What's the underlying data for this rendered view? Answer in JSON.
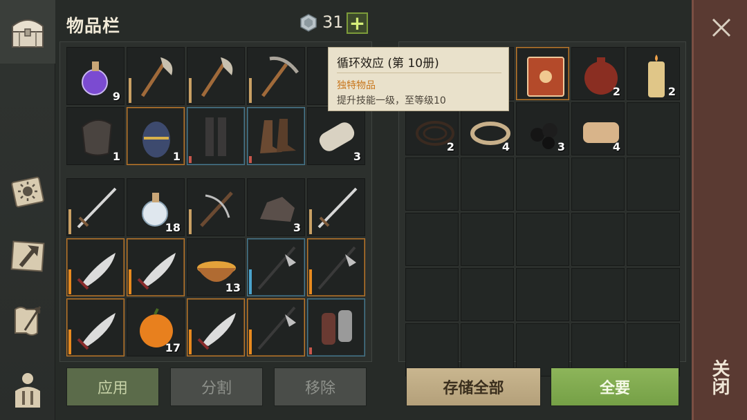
{
  "header": {
    "title": "物品栏",
    "currency_count": "31",
    "add_label": "+"
  },
  "sidebar": {
    "tabs": [
      {
        "name": "chest-tab",
        "icon": "chest-icon",
        "active": true
      },
      {
        "name": "book-tab",
        "icon": "sun-book-icon"
      },
      {
        "name": "craft-tab",
        "icon": "hammer-icon"
      },
      {
        "name": "recipes-tab",
        "icon": "scroll-quill-icon"
      },
      {
        "name": "character-tab",
        "icon": "character-icon"
      }
    ]
  },
  "tooltip": {
    "title": "循环效应 (第 10册)",
    "type": "独特物品",
    "description": "提升技能一级，至等级10"
  },
  "left_top_grid": [
    {
      "item": "purple-potion",
      "count": "9"
    },
    {
      "item": "axe",
      "dur": "tan"
    },
    {
      "item": "axe",
      "dur": "tan"
    },
    {
      "item": "pickaxe",
      "dur": "tan"
    },
    {
      "item": "tooltip-covered"
    },
    {
      "item": "shoulder-pad",
      "count": "1"
    },
    {
      "item": "egg",
      "count": "1",
      "hl": "orange"
    },
    {
      "item": "leg-armor",
      "hl": "blue",
      "dur": "red"
    },
    {
      "item": "boots",
      "hl": "blue",
      "dur": "red"
    },
    {
      "item": "log",
      "count": "3"
    }
  ],
  "left_bottom_grid": [
    {
      "item": "sword",
      "dur": "tan"
    },
    {
      "item": "white-potion",
      "count": "18"
    },
    {
      "item": "crossbow",
      "dur": "tan"
    },
    {
      "item": "ore",
      "count": "3"
    },
    {
      "item": "sword",
      "dur": "tan"
    },
    {
      "item": "scimitar",
      "hl": "orange",
      "dur": "orange"
    },
    {
      "item": "scimitar",
      "hl": "orange",
      "dur": "orange"
    },
    {
      "item": "stew",
      "count": "13"
    },
    {
      "item": "halberd",
      "hl": "blue",
      "dur": "blue"
    },
    {
      "item": "halberd",
      "hl": "orange",
      "dur": "orange"
    },
    {
      "item": "scimitar",
      "hl": "orange",
      "dur": "orange"
    },
    {
      "item": "pumpkin",
      "count": "17"
    },
    {
      "item": "scimitar",
      "hl": "orange",
      "dur": "orange"
    },
    {
      "item": "halberd",
      "hl": "orange",
      "dur": "orange"
    },
    {
      "item": "gauntlets",
      "hl": "blue",
      "dur": "red"
    }
  ],
  "right_grid": [
    {
      "item": "tooltip-covered"
    },
    {
      "item": "tooltip-covered"
    },
    {
      "item": "sun-book",
      "hl": "orange"
    },
    {
      "item": "water-flask",
      "count": "2"
    },
    {
      "item": "candle",
      "count": "2"
    },
    {
      "item": "rope",
      "count": "2"
    },
    {
      "item": "rope-bundle",
      "count": "4"
    },
    {
      "item": "coal",
      "count": "3"
    },
    {
      "item": "cloth",
      "count": "4"
    },
    {
      "item": ""
    },
    {
      "item": ""
    },
    {
      "item": ""
    },
    {
      "item": ""
    },
    {
      "item": ""
    },
    {
      "item": ""
    },
    {
      "item": ""
    },
    {
      "item": ""
    },
    {
      "item": ""
    },
    {
      "item": ""
    },
    {
      "item": ""
    },
    {
      "item": ""
    },
    {
      "item": ""
    },
    {
      "item": ""
    },
    {
      "item": ""
    },
    {
      "item": ""
    },
    {
      "item": ""
    },
    {
      "item": ""
    },
    {
      "item": ""
    },
    {
      "item": ""
    },
    {
      "item": ""
    }
  ],
  "buttons": {
    "apply": "应用",
    "split": "分割",
    "remove": "移除",
    "store_all": "存储全部",
    "take_all": "全要",
    "close": "关闭"
  },
  "colors": {
    "orange_highlight": "#c07a2c",
    "blue_highlight": "#4b7a8e",
    "take_all_green": "#75a046",
    "close_panel": "#5a3a32"
  }
}
